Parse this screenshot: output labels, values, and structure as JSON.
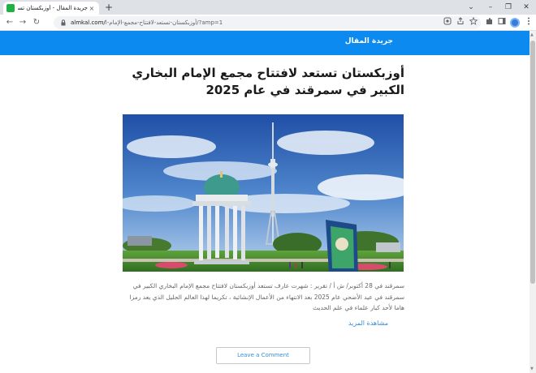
{
  "browser": {
    "tab_title": "جريدة المقال - أوزبكستان تستعد",
    "tab_close": "×",
    "new_tab": "+",
    "url_host": "almkal.com/",
    "url_path": "أوزبكستان-تستعد-لافتتاح-مجمع-الإمام-ا/?amp=1",
    "window_controls": {
      "dropdown": "⌄",
      "minimize": "–",
      "restore": "❐",
      "close": "✕"
    },
    "nav": {
      "back": "←",
      "forward": "→",
      "reload": "↻"
    }
  },
  "site": {
    "name": "جريدة المقال"
  },
  "article": {
    "title": "أوزبكستان تستعد لافتتاح مجمع الإمام البخاري الكبير في سمرقند في عام 2025",
    "excerpt": "سمرقند في 28 أكتوبر/ ش أ / تقرير : شهرت عارف تستعد أوزبكستان لافتتاح مجمع الإمام البخاري الكبير في سمرقند في عيد الأضحي عام 2025 بعد الانتهاء من الأعمال الإنشائية ، تكريما لهذا العالم الجليل الذي يعد رمزا هاما لأحد كبار علماء في علم الحديث",
    "read_more": "مشاهدة المزيد",
    "image_icon": "photo-tashkent-tower-memorial"
  },
  "comments": {
    "button_label": "Leave a Comment"
  },
  "colors": {
    "header_bg": "#0d8af0",
    "link": "#3a8ed8",
    "favicon": "#1fb141"
  }
}
